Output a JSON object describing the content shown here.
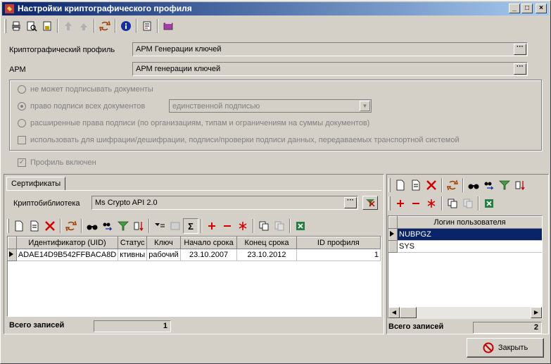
{
  "window": {
    "title": "Настройки криптографического профиля"
  },
  "form": {
    "profile_label": "Криптографический профиль",
    "profile_value": "АРМ Генерации ключей",
    "arm_label": "АРМ",
    "arm_value": "АРМ генерации ключей",
    "opt_cannot_sign": "не может подписывать документы",
    "opt_sign_all": "право подписи всех документов",
    "sign_mode_value": "единственной подписью",
    "opt_extended": "расширенные права подписи (по организациям, типам и ограничениям на суммы документов)",
    "opt_encrypt": "использовать для шифрации/дешифрации, подписи/проверки подписи данных, передаваемых транспортной системой",
    "profile_enabled": "Профиль включен"
  },
  "certs": {
    "tab_label": "Сертификаты",
    "lib_label": "Криптобиблиотека",
    "lib_value": "Ms Crypto API 2.0",
    "columns": [
      "Идентификатор (UID)",
      "Статус",
      "Ключ",
      "Начало срока",
      "Конец срока",
      "ID профиля"
    ],
    "rows": [
      [
        "ADAE14D9B542FFBACA8D",
        "ктивны",
        "рабочий",
        "23.10.2007",
        "23.10.2012",
        "1"
      ]
    ],
    "total_label": "Всего записей",
    "total_value": "1"
  },
  "users": {
    "column": "Логин пользователя",
    "rows": [
      "NUBPGZ",
      "SYS"
    ],
    "total_label": "Всего записей",
    "total_value": "2"
  },
  "close_label": "Закрыть",
  "colors": {
    "title_start": "#0a246a",
    "title_end": "#a6caf0",
    "selection": "#0a246a",
    "close_icon": "#c00000"
  }
}
